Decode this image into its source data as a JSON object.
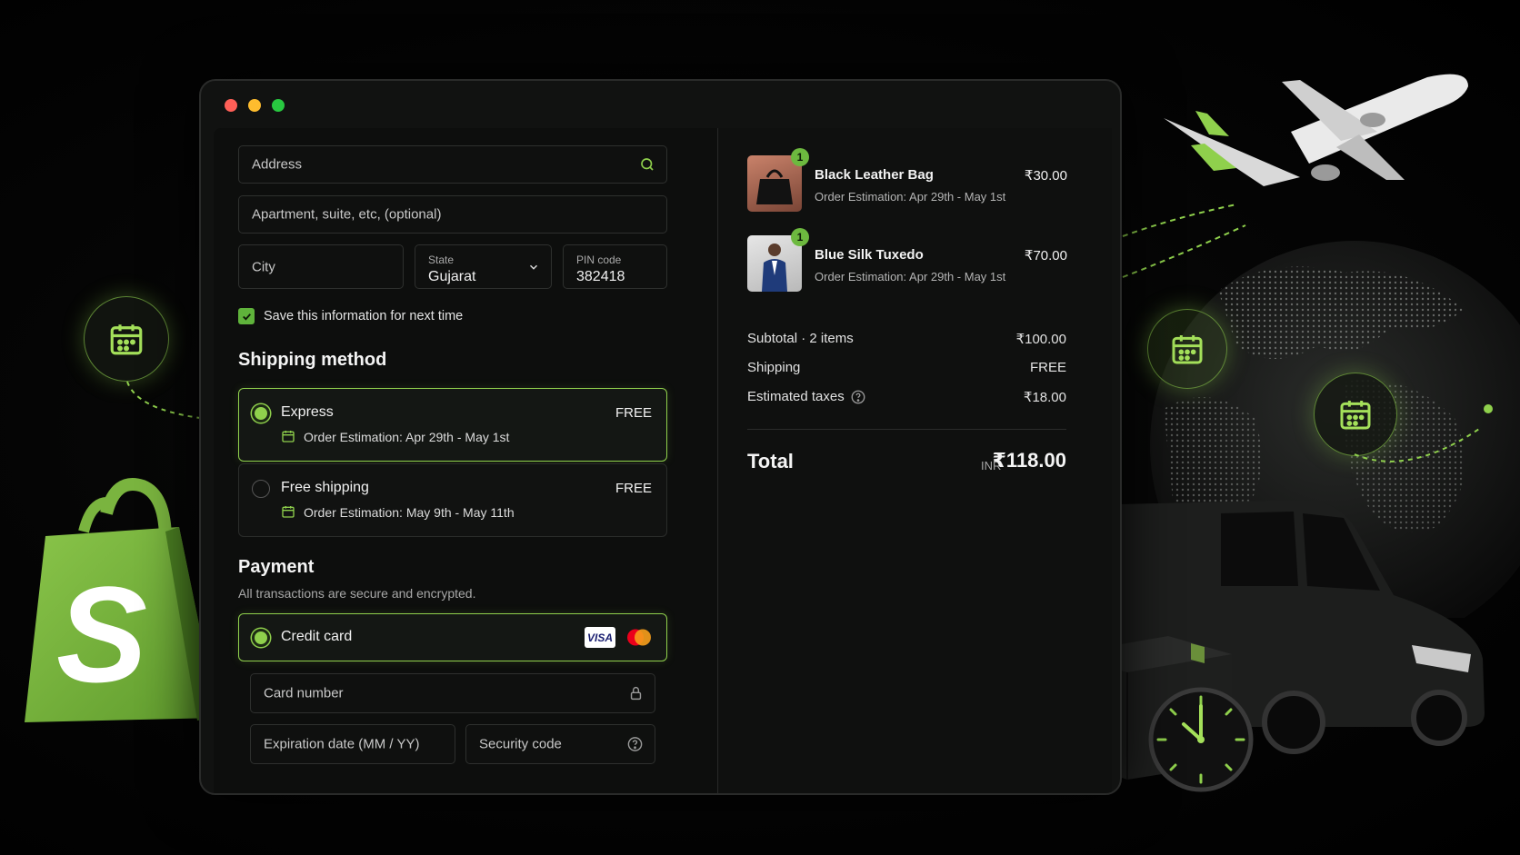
{
  "window": {
    "traffic_lights": [
      "#ff5f57",
      "#febc2e",
      "#28c840"
    ]
  },
  "address": {
    "address_placeholder": "Address",
    "apartment_placeholder": "Apartment, suite, etc, (optional)",
    "city_placeholder": "City",
    "state_label": "State",
    "state_value": "Gujarat",
    "pin_label": "PIN code",
    "pin_value": "382418",
    "save_info_label": "Save this information for next time",
    "save_info_checked": true
  },
  "shipping": {
    "title": "Shipping method",
    "options": [
      {
        "name": "Express",
        "price": "FREE",
        "estimate": "Order Estimation: Apr 29th - May 1st",
        "selected": true
      },
      {
        "name": "Free shipping",
        "price": "FREE",
        "estimate": "Order Estimation: May 9th - May 11th",
        "selected": false
      }
    ]
  },
  "payment": {
    "title": "Payment",
    "subtitle": "All transactions are secure and encrypted.",
    "method": "Credit card",
    "card_brands": [
      "VISA",
      "mastercard"
    ],
    "card_number_placeholder": "Card number",
    "expiry_placeholder": "Expiration date (MM / YY)",
    "security_placeholder": "Security code"
  },
  "order": {
    "items": [
      {
        "name": "Black Leather Bag",
        "price": "₹30.00",
        "estimate": "Order Estimation: Apr 29th - May 1st",
        "qty": "1"
      },
      {
        "name": "Blue Silk Tuxedo",
        "price": "₹70.00",
        "estimate": "Order Estimation: Apr 29th - May 1st",
        "qty": "1"
      }
    ],
    "subtotal_label": "Subtotal · 2 items",
    "subtotal_value": "₹100.00",
    "shipping_label": "Shipping",
    "shipping_value": "FREE",
    "taxes_label": "Estimated taxes",
    "taxes_value": "₹18.00",
    "total_label": "Total",
    "total_currency": "INR",
    "total_value": "₹118.00"
  },
  "colors": {
    "accent": "#8fd04c",
    "brand_green": "#6db93f",
    "background": "#000000"
  },
  "icons": [
    "search-icon",
    "chevron-down-icon",
    "check-icon",
    "calendar-icon",
    "lock-icon",
    "help-icon",
    "shopify-bag-icon",
    "airplane-icon",
    "globe-icon",
    "delivery-van-icon",
    "package-box-icon",
    "clock-icon",
    "location-pin-icon"
  ]
}
